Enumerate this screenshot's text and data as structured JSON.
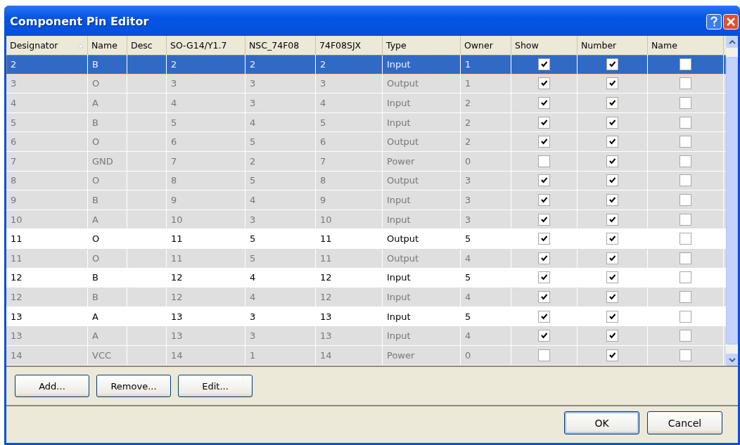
{
  "window": {
    "title": "Component Pin Editor"
  },
  "table": {
    "columns": [
      {
        "label": "Designator",
        "sorted": true
      },
      {
        "label": "Name",
        "sorted": false
      },
      {
        "label": "Desc",
        "sorted": false
      },
      {
        "label": "SO-G14/Y1.7",
        "sorted": false
      },
      {
        "label": "NSC_74F08",
        "sorted": false
      },
      {
        "label": "74F08SJX",
        "sorted": false
      },
      {
        "label": "Type",
        "sorted": false
      },
      {
        "label": "Owner",
        "sorted": false
      },
      {
        "label": "Show",
        "sorted": false
      },
      {
        "label": "Number",
        "sorted": false
      },
      {
        "label": "Name",
        "sorted": false
      }
    ],
    "rows": [
      {
        "cells": [
          "2",
          "B",
          "",
          "2",
          "2",
          "2",
          "Input",
          "1"
        ],
        "show": true,
        "number": true,
        "name": false,
        "selected": true,
        "dimmed": true
      },
      {
        "cells": [
          "3",
          "O",
          "",
          "3",
          "3",
          "3",
          "Output",
          "1"
        ],
        "show": true,
        "number": true,
        "name": false,
        "selected": false,
        "dimmed": true
      },
      {
        "cells": [
          "4",
          "A",
          "",
          "4",
          "3",
          "4",
          "Input",
          "2"
        ],
        "show": true,
        "number": true,
        "name": false,
        "selected": false,
        "dimmed": true
      },
      {
        "cells": [
          "5",
          "B",
          "",
          "5",
          "4",
          "5",
          "Input",
          "2"
        ],
        "show": true,
        "number": true,
        "name": false,
        "selected": false,
        "dimmed": true
      },
      {
        "cells": [
          "6",
          "O",
          "",
          "6",
          "5",
          "6",
          "Output",
          "2"
        ],
        "show": true,
        "number": true,
        "name": false,
        "selected": false,
        "dimmed": true
      },
      {
        "cells": [
          "7",
          "GND",
          "",
          "7",
          "2",
          "7",
          "Power",
          "0"
        ],
        "show": false,
        "number": true,
        "name": false,
        "selected": false,
        "dimmed": true
      },
      {
        "cells": [
          "8",
          "O",
          "",
          "8",
          "5",
          "8",
          "Output",
          "3"
        ],
        "show": true,
        "number": true,
        "name": false,
        "selected": false,
        "dimmed": true
      },
      {
        "cells": [
          "9",
          "B",
          "",
          "9",
          "4",
          "9",
          "Input",
          "3"
        ],
        "show": true,
        "number": true,
        "name": false,
        "selected": false,
        "dimmed": true
      },
      {
        "cells": [
          "10",
          "A",
          "",
          "10",
          "3",
          "10",
          "Input",
          "3"
        ],
        "show": true,
        "number": true,
        "name": false,
        "selected": false,
        "dimmed": true
      },
      {
        "cells": [
          "11",
          "O",
          "",
          "11",
          "5",
          "11",
          "Output",
          "5"
        ],
        "show": true,
        "number": true,
        "name": false,
        "selected": false,
        "dimmed": false
      },
      {
        "cells": [
          "11",
          "O",
          "",
          "11",
          "5",
          "11",
          "Output",
          "4"
        ],
        "show": true,
        "number": true,
        "name": false,
        "selected": false,
        "dimmed": true
      },
      {
        "cells": [
          "12",
          "B",
          "",
          "12",
          "4",
          "12",
          "Input",
          "5"
        ],
        "show": true,
        "number": true,
        "name": false,
        "selected": false,
        "dimmed": false
      },
      {
        "cells": [
          "12",
          "B",
          "",
          "12",
          "4",
          "12",
          "Input",
          "4"
        ],
        "show": true,
        "number": true,
        "name": false,
        "selected": false,
        "dimmed": true
      },
      {
        "cells": [
          "13",
          "A",
          "",
          "13",
          "3",
          "13",
          "Input",
          "5"
        ],
        "show": true,
        "number": true,
        "name": false,
        "selected": false,
        "dimmed": false
      },
      {
        "cells": [
          "13",
          "A",
          "",
          "13",
          "3",
          "13",
          "Input",
          "4"
        ],
        "show": true,
        "number": true,
        "name": false,
        "selected": false,
        "dimmed": true
      },
      {
        "cells": [
          "14",
          "VCC",
          "",
          "14",
          "1",
          "14",
          "Power",
          "0"
        ],
        "show": false,
        "number": true,
        "name": false,
        "selected": false,
        "dimmed": true
      }
    ]
  },
  "edit_buttons": [
    "Add...",
    "Remove...",
    "Edit..."
  ],
  "dialog_buttons": [
    "OK",
    "Cancel"
  ]
}
